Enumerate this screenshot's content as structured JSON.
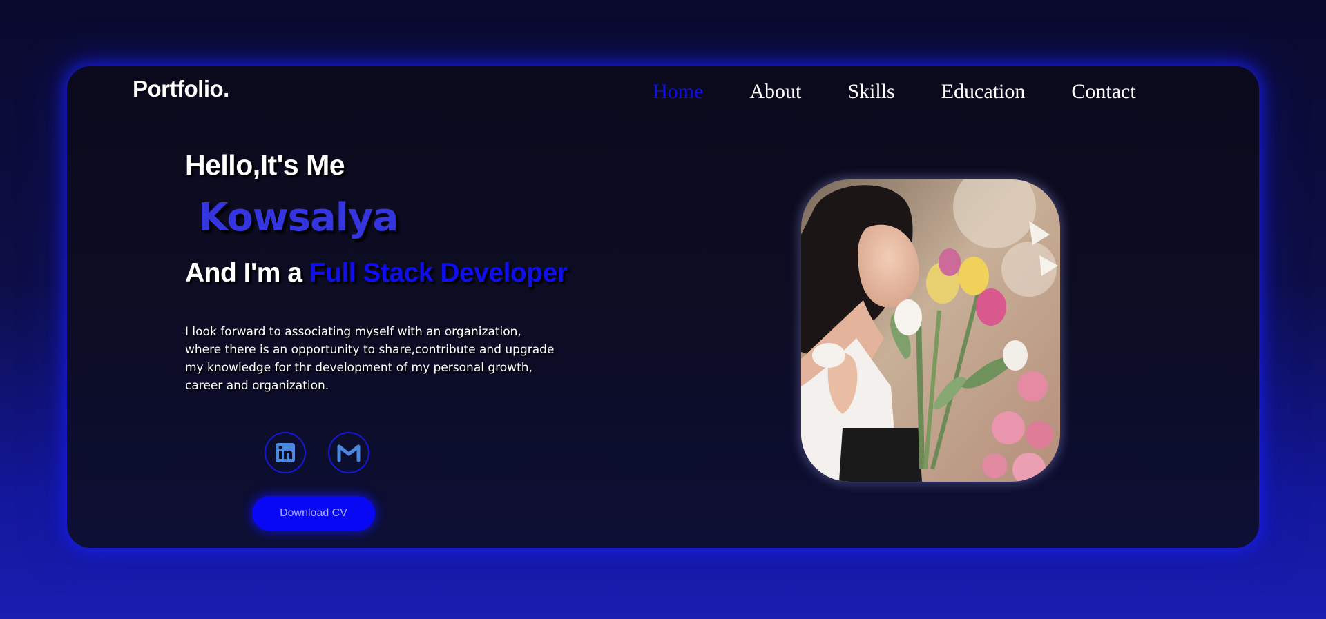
{
  "brand": {
    "logo": "Portfolio."
  },
  "nav": {
    "items": [
      {
        "label": "Home",
        "active": true
      },
      {
        "label": "About",
        "active": false
      },
      {
        "label": "Skills",
        "active": false
      },
      {
        "label": "Education",
        "active": false
      },
      {
        "label": "Contact",
        "active": false
      }
    ]
  },
  "hero": {
    "greeting": "Hello,It's Me",
    "name": "Kowsalya",
    "role_prefix": "And I'm a ",
    "role_highlight": "Full Stack Developer",
    "description": "I look forward to associating myself with an organization, where there is an opportunity to share,contribute and upgrade my knowledge for thr development of my personal growth, career and organization.",
    "download_label": "Download CV"
  },
  "socials": [
    {
      "icon": "linkedin-icon"
    },
    {
      "icon": "gmail-icon"
    }
  ],
  "colors": {
    "accent": "#0808f5",
    "name": "#3535e0",
    "active_nav": "#1010e0",
    "card_bg": "#0b0a1c",
    "glow": "#1a1eeb"
  }
}
